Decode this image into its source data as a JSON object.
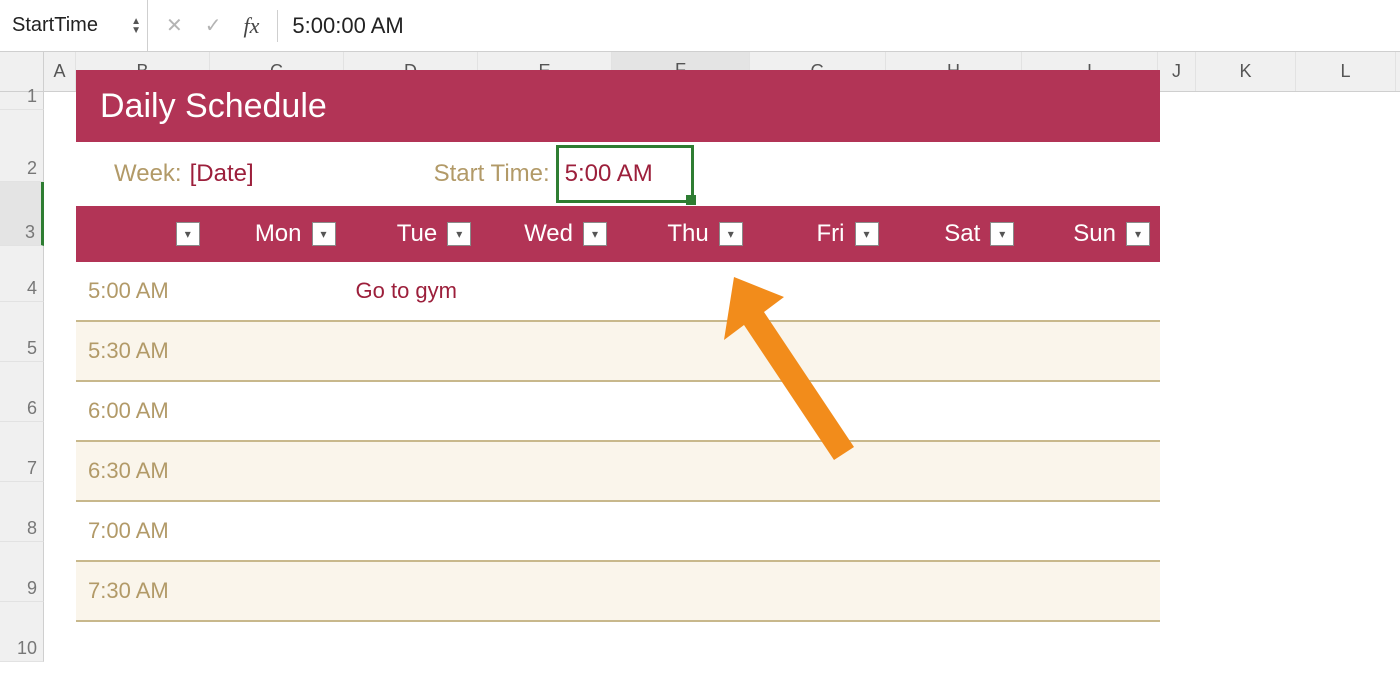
{
  "formula_bar": {
    "name_box": "StartTime",
    "cancel_icon": "✕",
    "confirm_icon": "✓",
    "fx_label": "fx",
    "value": "5:00:00 AM"
  },
  "columns": [
    "A",
    "B",
    "C",
    "D",
    "E",
    "F",
    "G",
    "H",
    "I",
    "J",
    "K",
    "L"
  ],
  "active_column": "F",
  "row_numbers": [
    1,
    2,
    3,
    4,
    5,
    6,
    7,
    8,
    9,
    10
  ],
  "active_row": 3,
  "template": {
    "title": "Daily Schedule",
    "week_label": "Week:",
    "week_value": "[Date]",
    "start_time_label": "Start Time:",
    "start_time_value": "5:00 AM",
    "day_headers": [
      "",
      "Mon",
      "Tue",
      "Wed",
      "Thu",
      "Fri",
      "Sat",
      "Sun"
    ],
    "time_slots": [
      "5:00 AM",
      "5:30 AM",
      "6:00 AM",
      "6:30 AM",
      "7:00 AM",
      "7:30 AM"
    ],
    "entries": {
      "0": {
        "Tue": "Go to gym"
      }
    }
  },
  "colors": {
    "maroon": "#B23456",
    "maroon_text": "#9C1F3B",
    "tan": "#B29A68",
    "selection": "#2e7d32",
    "arrow": "#F28C1B"
  }
}
